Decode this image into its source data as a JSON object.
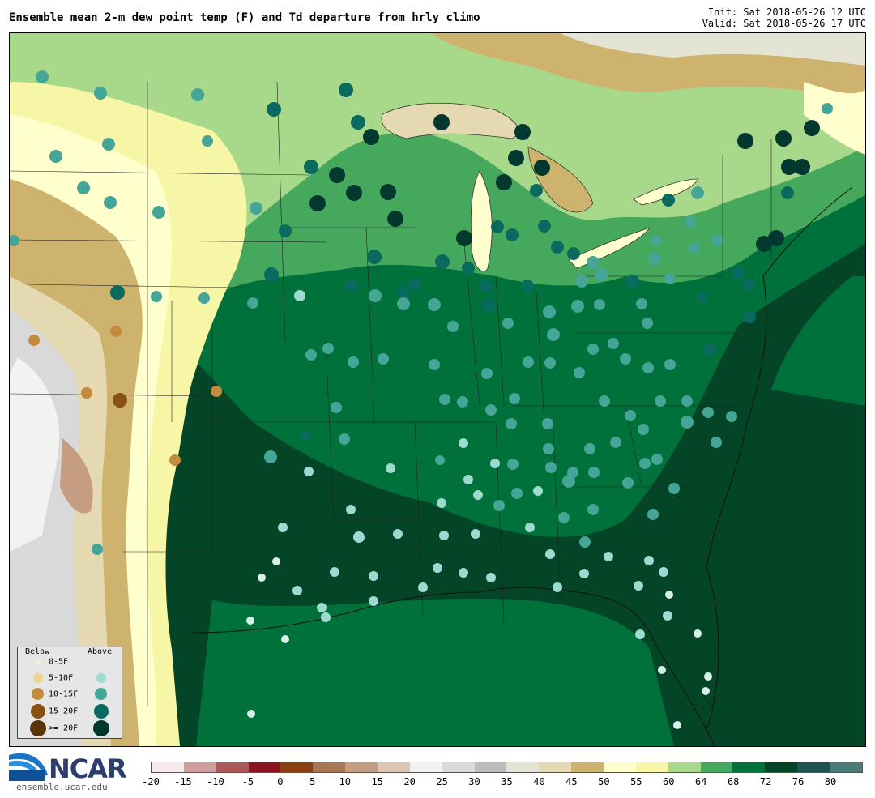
{
  "title": "Ensemble mean 2-m dew point temp (F) and Td departure from hrly climo",
  "init_label": "Init: Sat 2018-05-26 12 UTC",
  "valid_label": "Valid: Sat 2018-05-26 17 UTC",
  "logo": {
    "name": "NCAR",
    "url": "ensemble.ucar.edu"
  },
  "legend": {
    "below_header": "Below",
    "above_header": "Above",
    "rows": [
      {
        "label": "0-5F",
        "below_color": "#f5f1d6",
        "above_color": "#d6f0ea"
      },
      {
        "label": "5-10F",
        "below_color": "#ecd497",
        "above_color": "#9fdad0"
      },
      {
        "label": "10-15F",
        "below_color": "#c58b3c",
        "above_color": "#45a596"
      },
      {
        "label": "15-20F",
        "below_color": "#8a5212",
        "above_color": "#0b6a60"
      },
      {
        "label": ">= 20F",
        "below_color": "#5c3208",
        "above_color": "#03382f"
      }
    ]
  },
  "colorbar": {
    "ticks": [
      "-20",
      "-15",
      "-10",
      "-5",
      "0",
      "5",
      "10",
      "15",
      "20",
      "25",
      "30",
      "35",
      "40",
      "45",
      "50",
      "55",
      "60",
      "64",
      "68",
      "72",
      "76",
      "80"
    ],
    "colors": [
      "#f6e9e9",
      "#d29d9d",
      "#ad5858",
      "#8a1420",
      "#8a4010",
      "#a87652",
      "#c49d82",
      "#e0c5b2",
      "#f2f2f2",
      "#d9d9d9",
      "#bcbcbc",
      "#e4e4d4",
      "#e5d9b1",
      "#cdb36e",
      "#ffffce",
      "#f7f5a6",
      "#a8d98b",
      "#45a85c",
      "#00713a",
      "#044528",
      "#1c544f",
      "#4a7b78"
    ]
  }
}
